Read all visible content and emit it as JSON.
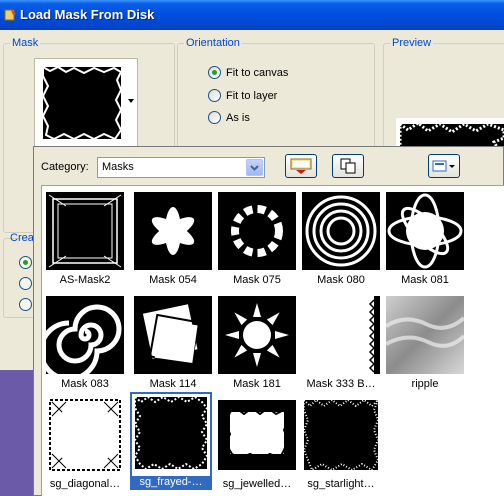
{
  "window": {
    "title": "Load Mask From Disk"
  },
  "mask_group": {
    "label": "Mask"
  },
  "orientation": {
    "label": "Orientation",
    "options": [
      {
        "label": "Fit to canvas",
        "selected": true
      },
      {
        "label": "Fit to layer",
        "selected": false
      },
      {
        "label": "As is",
        "selected": false
      }
    ]
  },
  "preview": {
    "label": "Preview"
  },
  "create": {
    "label": "Crea"
  },
  "browser": {
    "category_label": "Category:",
    "category_value": "Masks",
    "items": [
      {
        "label": "AS-Mask2",
        "selected": false
      },
      {
        "label": "Mask 054",
        "selected": false
      },
      {
        "label": "Mask 075",
        "selected": false
      },
      {
        "label": "Mask 080",
        "selected": false
      },
      {
        "label": "Mask 081",
        "selected": false
      },
      {
        "label": "Mask 083",
        "selected": false
      },
      {
        "label": "Mask 114",
        "selected": false
      },
      {
        "label": "Mask 181",
        "selected": false
      },
      {
        "label": "Mask 333 B…",
        "selected": false
      },
      {
        "label": "ripple",
        "selected": false
      },
      {
        "label": "sg_diagonal…",
        "selected": false
      },
      {
        "label": "sg_frayed-…",
        "selected": true
      },
      {
        "label": "sg_jewelled…",
        "selected": false
      },
      {
        "label": "sg_starlight…",
        "selected": false
      }
    ]
  },
  "colors": {
    "title_bar": "#0050e0",
    "selection": "#316ac5",
    "group_label": "#0046d5",
    "background": "#6a5aa8"
  }
}
